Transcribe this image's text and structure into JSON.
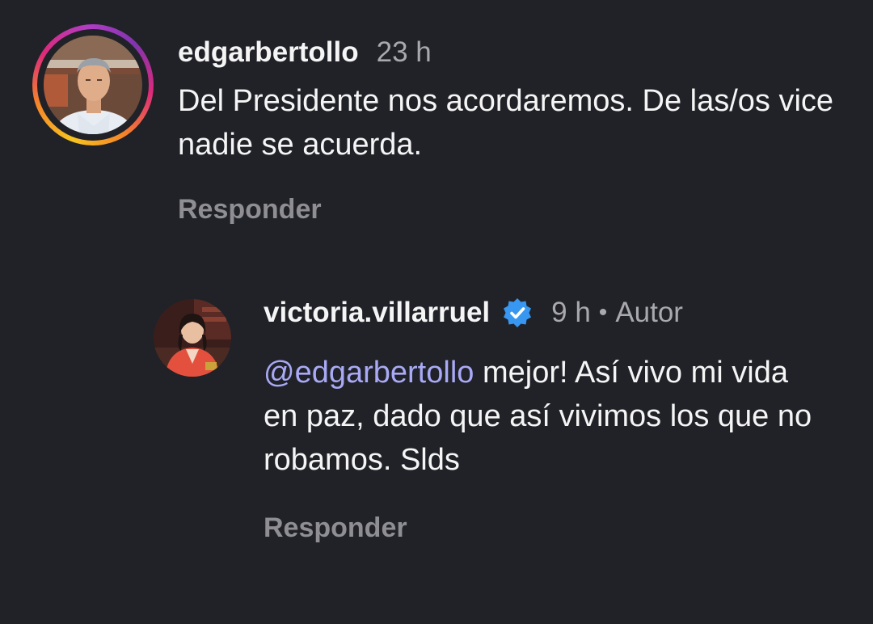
{
  "comments": [
    {
      "username": "edgarbertollo",
      "time": "23 h",
      "text": "Del Presidente nos acordaremos.  De las/os vice nadie se acuerda.",
      "reply_label": "Responder",
      "avatar_icon": "profile-photo-man",
      "has_story_ring": true
    }
  ],
  "reply": {
    "username": "victoria.villarruel",
    "verified_icon": "verified-badge-icon",
    "verified_color": "#3897f0",
    "time": "9 h",
    "separator": "•",
    "author_label": "Autor",
    "mention": "@edgarbertollo",
    "text": " mejor! Así vivo mi vida en paz, dado que así vivimos los que no robamos. Slds",
    "reply_label": "Responder",
    "avatar_icon": "profile-photo-woman"
  },
  "colors": {
    "background": "#202228",
    "text": "#f5f5f5",
    "muted": "#a8a8ad",
    "mention": "#a9a9f5"
  }
}
